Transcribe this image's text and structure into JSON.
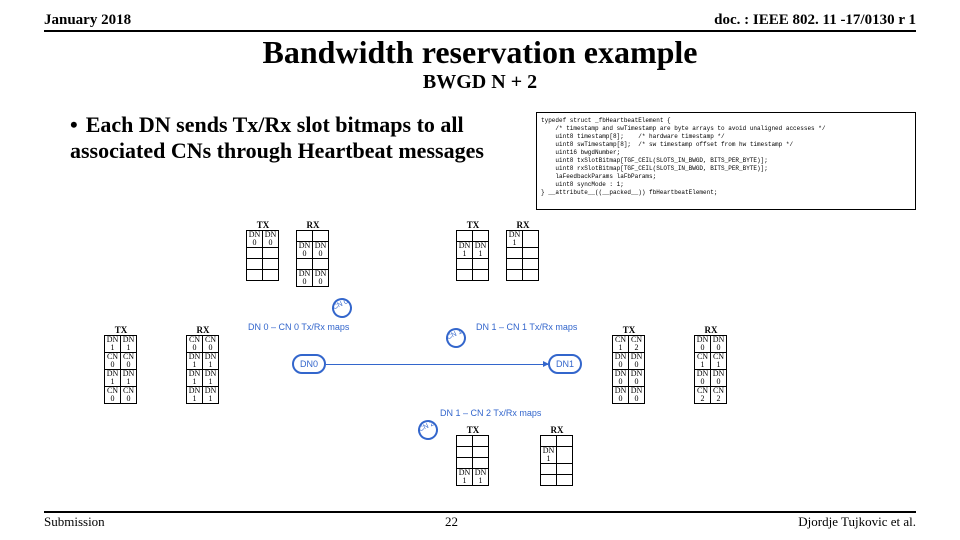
{
  "header": {
    "left": "January 2018",
    "right": "doc. : IEEE 802. 11 -17/0130 r 1"
  },
  "title": "Bandwidth reservation example",
  "subtitle": "BWGD N + 2",
  "bullet": "Each DN sends Tx/Rx slot bitmaps to all associated CNs through Heartbeat messages",
  "code": "typedef struct _fbHeartbeatElement {\n    /* timestamp and swTimestamp are byte arrays to avoid unaligned accesses */\n    uint8 timestamp[8];    /* hardware timestamp */\n    uint8 swTimestamp[8];  /* sw timestamp offset from hw timestamp */\n    uint16 bwgdNumber;\n    uint8 txSlotBitmap[TGF_CEIL(SLOTS_IN_BWGD, BITS_PER_BYTE)];\n    uint8 rxSlotBitmap[TGF_CEIL(SLOTS_IN_BWGD, BITS_PER_BYTE)];\n    laFeedbackParams laFbParams;\n    uint8 syncMode : 1;\n} __attribute__((__packed__)) fbHeartbeatElement;",
  "labels": {
    "tx": "TX",
    "rx": "RX",
    "dn0": "DN 0",
    "dn1": "DN 1",
    "cn0": "CN 0",
    "cn1": "CN 1",
    "cn2": "CN 2"
  },
  "tables": {
    "topA_tx": [
      [
        "DN 0",
        "DN 0"
      ],
      [
        "",
        ""
      ],
      [
        "",
        ""
      ],
      [
        "",
        ""
      ]
    ],
    "topA_rx": [
      [
        "",
        ""
      ],
      [
        "DN 0",
        "DN 0"
      ],
      [
        "",
        ""
      ],
      [
        "DN 0",
        "DN 0"
      ]
    ],
    "topB_tx": [
      [
        "",
        ""
      ],
      [
        "DN 1",
        "DN 1"
      ],
      [
        "",
        ""
      ],
      [
        "",
        ""
      ]
    ],
    "topB_rx": [
      [
        "DN 1",
        ""
      ],
      [
        "",
        ""
      ],
      [
        "",
        ""
      ],
      [
        "",
        ""
      ]
    ],
    "leftA_tx": [
      [
        "DN 1",
        "DN 1"
      ],
      [
        "CN 0",
        "CN 0"
      ],
      [
        "DN 1",
        "DN 1"
      ],
      [
        "CN 0",
        "CN 0"
      ]
    ],
    "leftA_rx": [
      [
        "CN 0",
        "CN 0"
      ],
      [
        "DN 1",
        "DN 1"
      ],
      [
        "DN 1",
        "DN 1"
      ],
      [
        "DN 1",
        "DN 1"
      ]
    ],
    "rightA_tx": [
      [
        "CN 1",
        "CN 2"
      ],
      [
        "DN 0",
        "DN 0"
      ],
      [
        "DN 0",
        "DN 0"
      ],
      [
        "DN 0",
        "DN 0"
      ]
    ],
    "rightA_rx": [
      [
        "DN 0",
        "DN 0"
      ],
      [
        "CN 1",
        "CN 1"
      ],
      [
        "DN 0",
        "DN 0"
      ],
      [
        "CN 2",
        "CN 2"
      ]
    ],
    "botA_tx": [
      [
        "",
        ""
      ],
      [
        "",
        ""
      ],
      [
        "",
        ""
      ],
      [
        "DN 1",
        "DN 1"
      ]
    ],
    "botA_rx": [
      [
        "",
        ""
      ],
      [
        "DN 1",
        ""
      ],
      [
        "",
        ""
      ],
      [
        "",
        ""
      ]
    ]
  },
  "maps": {
    "a": "DN 0 – CN 0 Tx/Rx maps",
    "b": "DN 1 – CN 1 Tx/Rx maps",
    "c": "DN 1 – CN 2 Tx/Rx maps"
  },
  "nodes": {
    "dn0": "DN0",
    "dn1": "DN1",
    "cn0": "CN\n0",
    "cn1": "CN\n1",
    "cn2": "CN\n2"
  },
  "footer": {
    "left": "Submission",
    "mid": "22",
    "right": "Djordje Tujkovic et al."
  }
}
